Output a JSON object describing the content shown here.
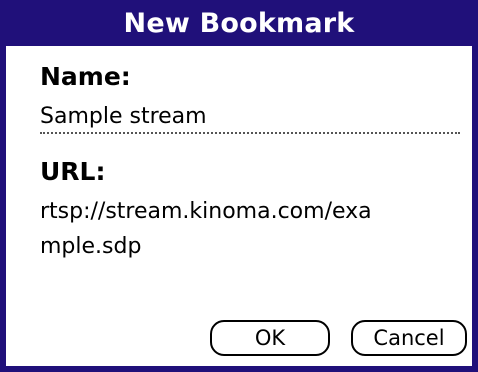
{
  "dialog": {
    "title": "New Bookmark",
    "name_label": "Name:",
    "name_value": "Sample stream",
    "url_label": "URL:",
    "url_value": "rtsp://stream.kinoma.com/exa\nmple.sdp",
    "ok_label": "OK",
    "cancel_label": "Cancel"
  },
  "colors": {
    "title_bar": "#20107a",
    "title_text": "#ffffff",
    "background": "#ffffff"
  }
}
